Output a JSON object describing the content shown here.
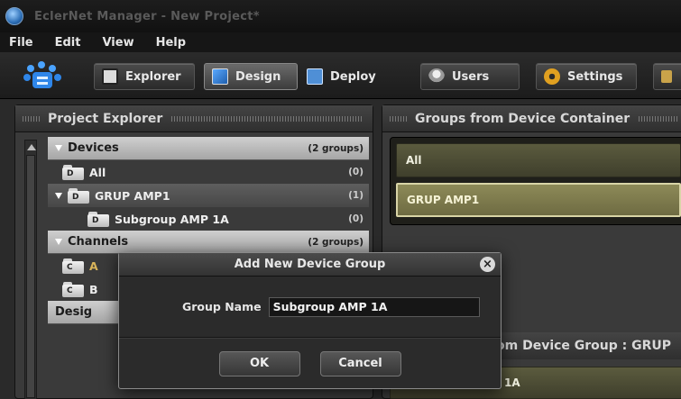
{
  "window": {
    "title": "EclerNet Manager - New Project*"
  },
  "menu": [
    "File",
    "Edit",
    "View",
    "Help"
  ],
  "toolbar": {
    "explorer": "Explorer",
    "design": "Design",
    "deploy": "Deploy",
    "users": "Users",
    "settings": "Settings"
  },
  "project_explorer": {
    "title": "Project Explorer",
    "devices": {
      "label": "Devices",
      "count": "(2 groups)"
    },
    "all": {
      "label": "All",
      "count": "(0)"
    },
    "grup_amp1": {
      "label": "GRUP AMP1",
      "count": "(1)"
    },
    "subgroup": {
      "label": "Subgroup AMP 1A",
      "count": "(0)"
    },
    "channels": {
      "label": "Channels",
      "count": "(2 groups)"
    },
    "ch_a_partial": "A",
    "ch_b_partial": "B",
    "design_partial": "Desig"
  },
  "groups_panel": {
    "title": "Groups from Device Container",
    "items": [
      "All",
      "GRUP AMP1"
    ],
    "bottom_title_partial": "om Device Group : GRUP",
    "bottom_item_partial": "1A"
  },
  "dialog": {
    "title": "Add New Device Group",
    "field_label": "Group Name",
    "field_value": "Subgroup AMP 1A",
    "ok": "OK",
    "cancel": "Cancel"
  },
  "colors": {
    "accent_selected_group": "#8d8a58",
    "deploy_icon": "#4f8fd6",
    "settings_icon": "#e0a020"
  }
}
